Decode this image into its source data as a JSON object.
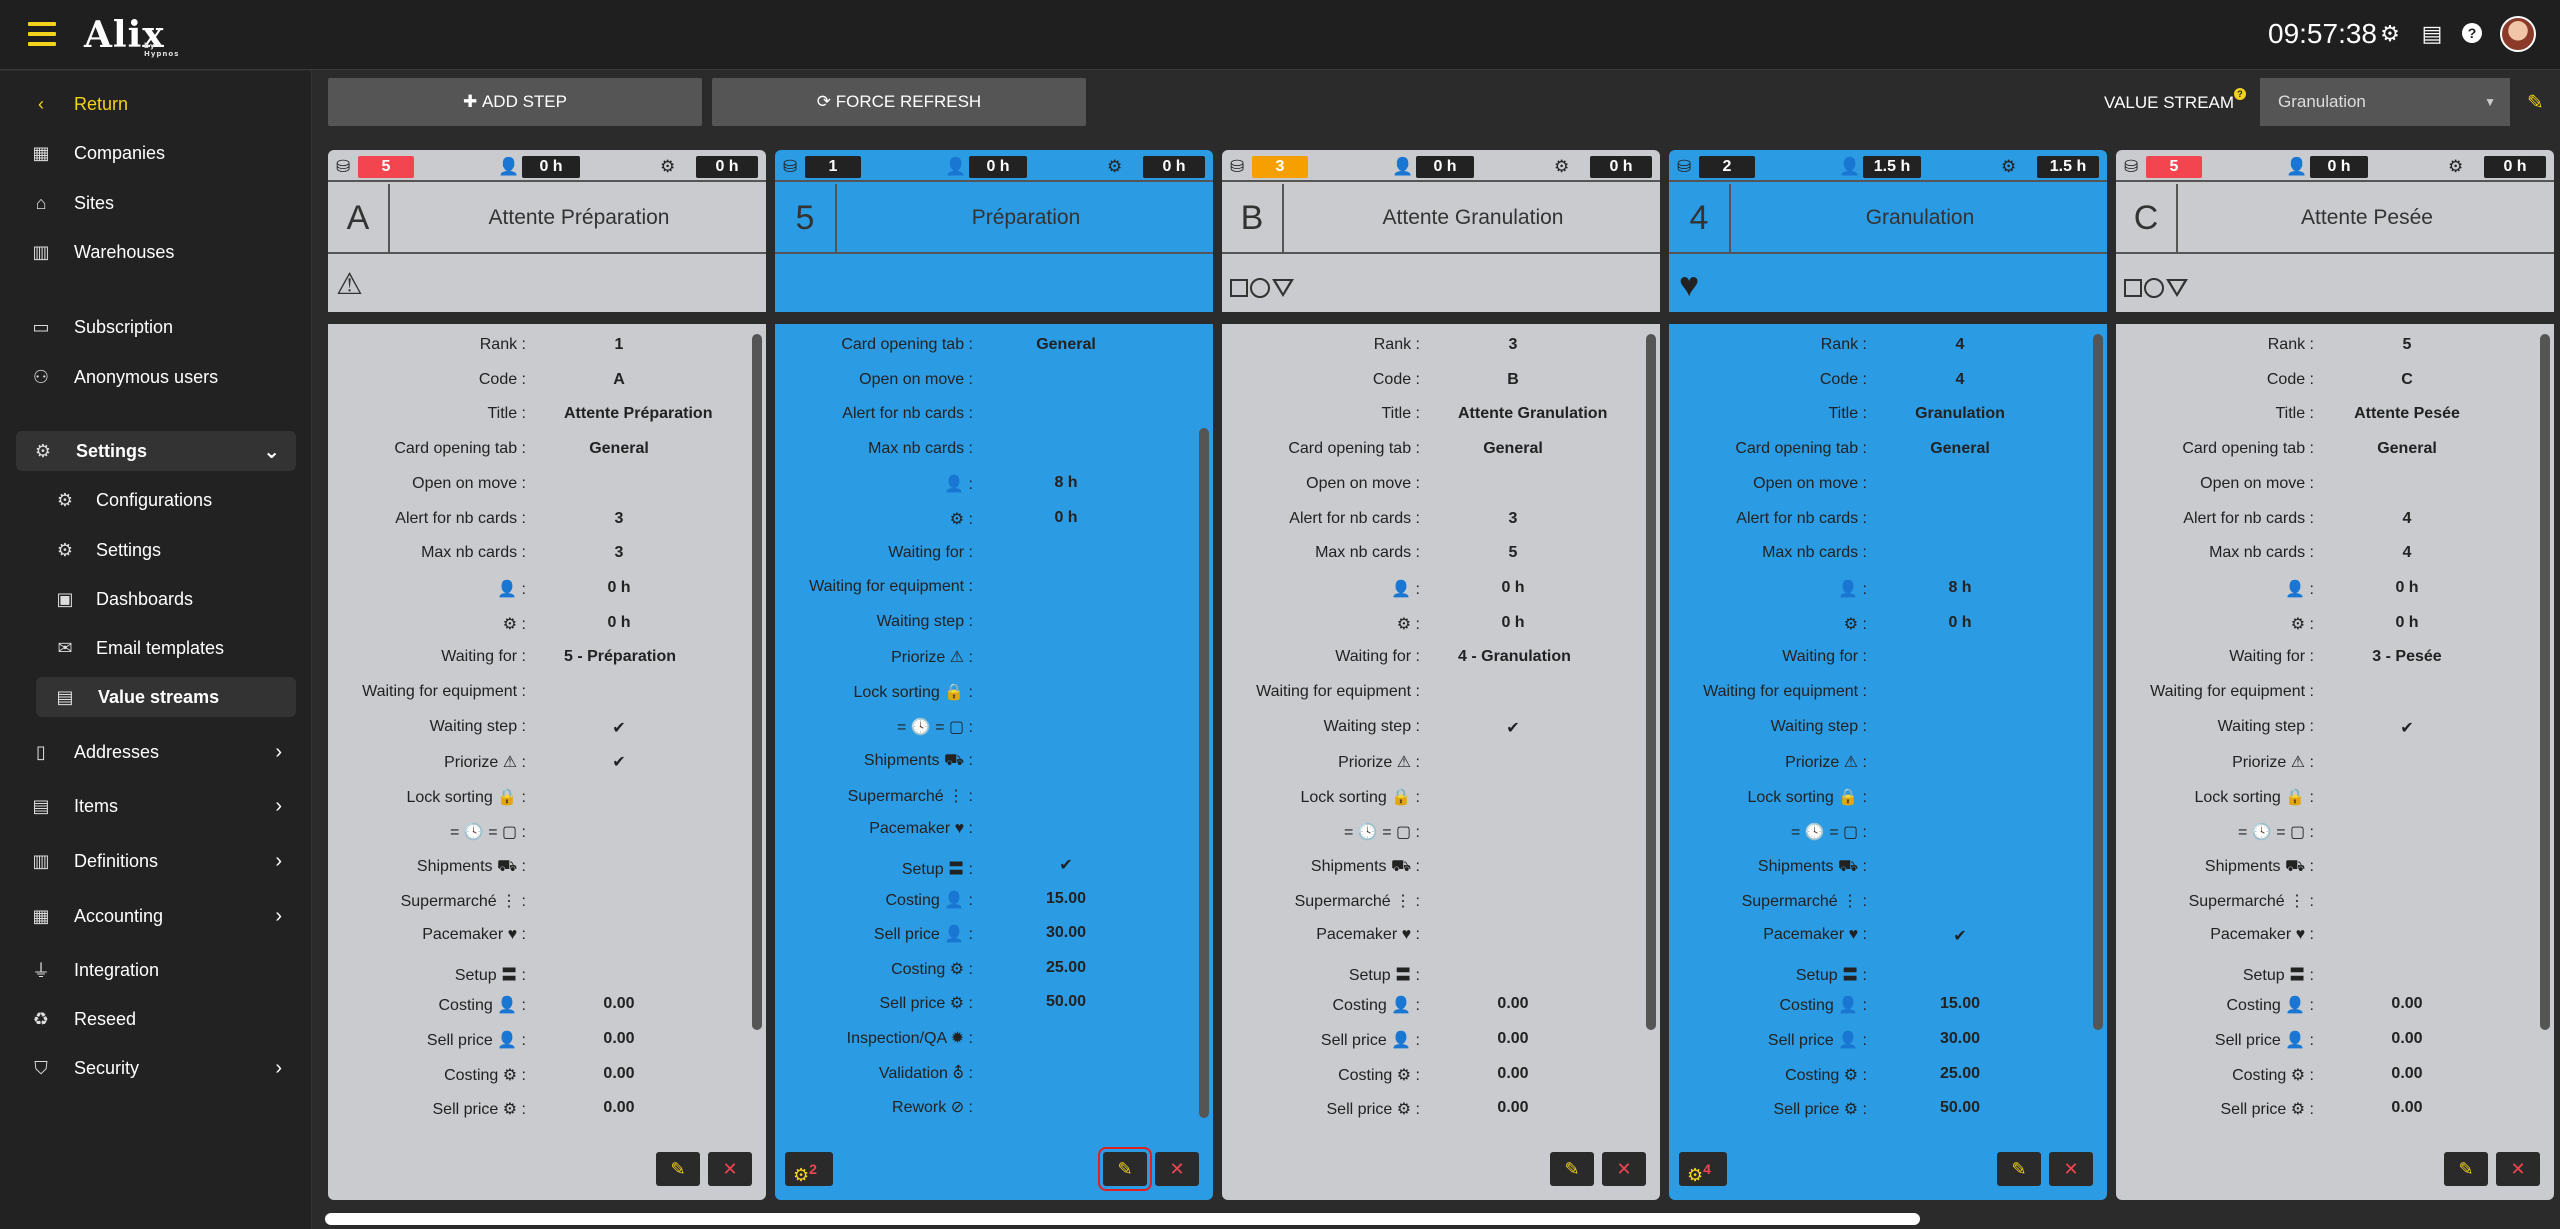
{
  "app": {
    "logo": "Alix",
    "logo_sub": "by Hypnos",
    "time": "09:57:38"
  },
  "toolbar": {
    "add_step": "ADD STEP",
    "force_refresh": "FORCE REFRESH",
    "value_stream_label": "VALUE STREAM",
    "value_stream_selected": "Granulation",
    "help": "?"
  },
  "sidebar": {
    "return": "Return",
    "items": [
      "Companies",
      "Sites",
      "Warehouses",
      "Subscription",
      "Anonymous users",
      "Settings",
      "Configurations",
      "Settings",
      "Dashboards",
      "Email templates",
      "Value streams",
      "Addresses",
      "Items",
      "Definitions",
      "Accounting",
      "Integration",
      "Reseed",
      "Security"
    ]
  },
  "labels": {
    "rank": "Rank :",
    "code": "Code :",
    "title": "Title :",
    "card_opening_tab": "Card opening tab :",
    "open_on_move": "Open on move :",
    "alert_nb_cards": "Alert for nb cards :",
    "max_nb_cards": "Max nb cards :",
    "waiting_for": "Waiting for :",
    "waiting_for_equipment": "Waiting for equipment :",
    "waiting_step": "Waiting step :",
    "priorize": "Priorize",
    "lock_sorting": "Lock sorting",
    "date_eq": "=",
    "shipments": "Shipments",
    "supermarche": "Supermarché",
    "pacemaker": "Pacemaker",
    "setup": "Setup",
    "costing": "Costing",
    "sell_price": "Sell price",
    "inspection": "Inspection/QA",
    "validation": "Validation",
    "rework": "Rework",
    "colon": ":"
  },
  "columns": [
    {
      "color": "grey",
      "cards": "5",
      "person_h": "0 h",
      "gear_h": "0 h",
      "code": "A",
      "title": "Attente Préparation",
      "icon": "warning",
      "rank": "1",
      "code_val": "A",
      "title_val": "Attente Préparation",
      "tab": "General",
      "alert": "3",
      "max": "3",
      "person": "0 h",
      "gear": "0 h",
      "waiting_for": "5 - Préparation",
      "waiting_step": "✔",
      "priorize": "✔",
      "costing_p": "0.00",
      "sell_p": "0.00",
      "costing_g": "0.00",
      "sell_g": "0.00"
    },
    {
      "color": "blue",
      "cards": "1",
      "person_h": "0 h",
      "gear_h": "0 h",
      "code": "5",
      "title": "Préparation",
      "tab": "General",
      "person": "8 h",
      "gear": "0 h",
      "setup": "✔",
      "costing_p": "15.00",
      "sell_p": "30.00",
      "costing_g": "25.00",
      "sell_g": "50.00",
      "gears_count": "2"
    },
    {
      "color": "grey",
      "cards": "3",
      "person_h": "0 h",
      "gear_h": "0 h",
      "code": "B",
      "title": "Attente Granulation",
      "icon": "shapes",
      "rank": "3",
      "code_val": "B",
      "title_val": "Attente Granulation",
      "tab": "General",
      "alert": "3",
      "max": "5",
      "person": "0 h",
      "gear": "0 h",
      "waiting_for": "4 - Granulation",
      "waiting_step": "✔",
      "costing_p": "0.00",
      "sell_p": "0.00",
      "costing_g": "0.00",
      "sell_g": "0.00"
    },
    {
      "color": "blue",
      "cards": "2",
      "person_h": "1.5 h",
      "gear_h": "1.5 h",
      "code": "4",
      "title": "Granulation",
      "icon": "heart",
      "rank": "4",
      "code_val": "4",
      "title_val": "Granulation",
      "tab": "General",
      "person": "8 h",
      "gear": "0 h",
      "pacemaker": "✔",
      "costing_p": "15.00",
      "sell_p": "30.00",
      "costing_g": "25.00",
      "sell_g": "50.00",
      "gears_count": "4"
    },
    {
      "color": "grey",
      "cards": "5",
      "person_h": "0 h",
      "gear_h": "0 h",
      "code": "C",
      "title": "Attente Pesée",
      "icon": "shapes",
      "rank": "5",
      "code_val": "C",
      "title_val": "Attente Pesée",
      "tab": "General",
      "alert": "4",
      "max": "4",
      "person": "0 h",
      "gear": "0 h",
      "waiting_for": "3 - Pesée",
      "waiting_step": "✔",
      "costing_p": "0.00",
      "sell_p": "0.00",
      "costing_g": "0.00",
      "sell_g": "0.00"
    }
  ]
}
